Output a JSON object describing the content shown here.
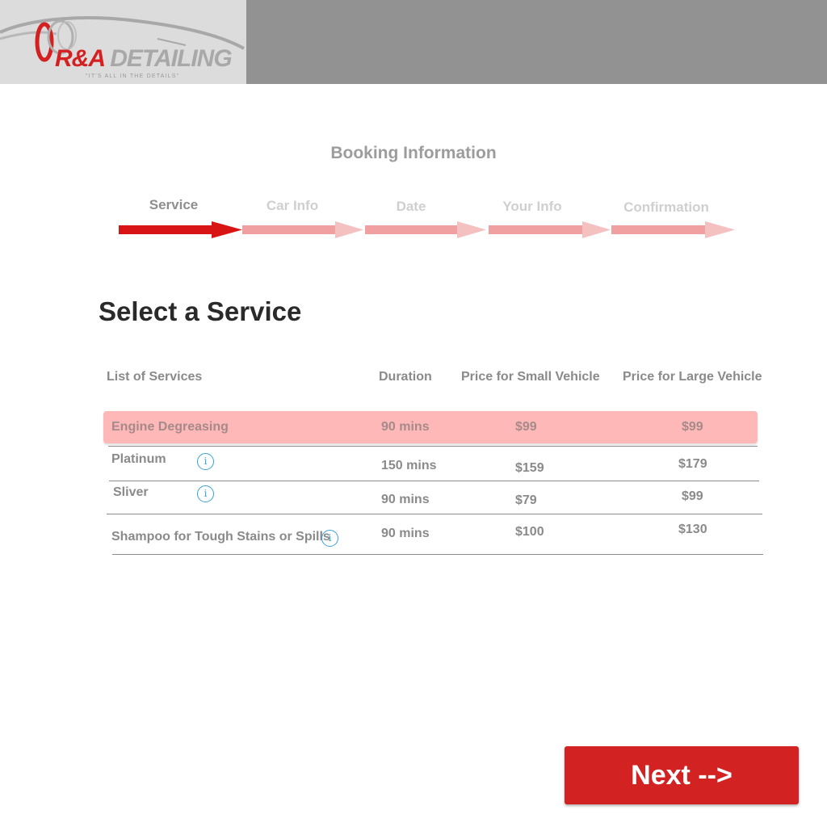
{
  "header": {
    "logo": {
      "brand_main": "R&A ",
      "brand_rest": "DETAILING",
      "tagline": "\"IT'S ALL IN THE DETAILS\""
    }
  },
  "booking": {
    "title": "Booking Information",
    "steps": [
      {
        "label": "Service",
        "active": true
      },
      {
        "label": "Car Info",
        "active": false
      },
      {
        "label": "Date",
        "active": false
      },
      {
        "label": "Your Info",
        "active": false
      },
      {
        "label": "Confirmation",
        "active": false
      }
    ]
  },
  "main": {
    "title": "Select a Service",
    "table": {
      "headers": {
        "service": "List of Services",
        "duration": "Duration",
        "small": "Price for Small Vehicle",
        "large": "Price for Large Vehicle"
      },
      "rows": [
        {
          "name": "Engine Degreasing",
          "duration": "90 mins",
          "small": "$99",
          "large": "$99",
          "selected": true,
          "info": false
        },
        {
          "name": "Platinum",
          "duration": "150 mins",
          "small": "$159",
          "large": "$179",
          "selected": false,
          "info": true
        },
        {
          "name": "Sliver",
          "duration": "90 mins",
          "small": "$79",
          "large": "$99",
          "selected": false,
          "info": true
        },
        {
          "name": "Shampoo for Tough Stains or Spills",
          "duration": "90 mins",
          "small": "$100",
          "large": "$130",
          "selected": false,
          "info": true
        }
      ]
    }
  },
  "footer": {
    "next_label": "Next -->"
  },
  "icons": {
    "info": "info-icon",
    "step_arrow": "arrow-right-icon"
  },
  "colors": {
    "accent": "#d32222",
    "step_active": "#d91414",
    "step_inactive": "#f0a0a0",
    "row_selected": "#ffb8b8",
    "info_icon": "#3a9fd8"
  }
}
